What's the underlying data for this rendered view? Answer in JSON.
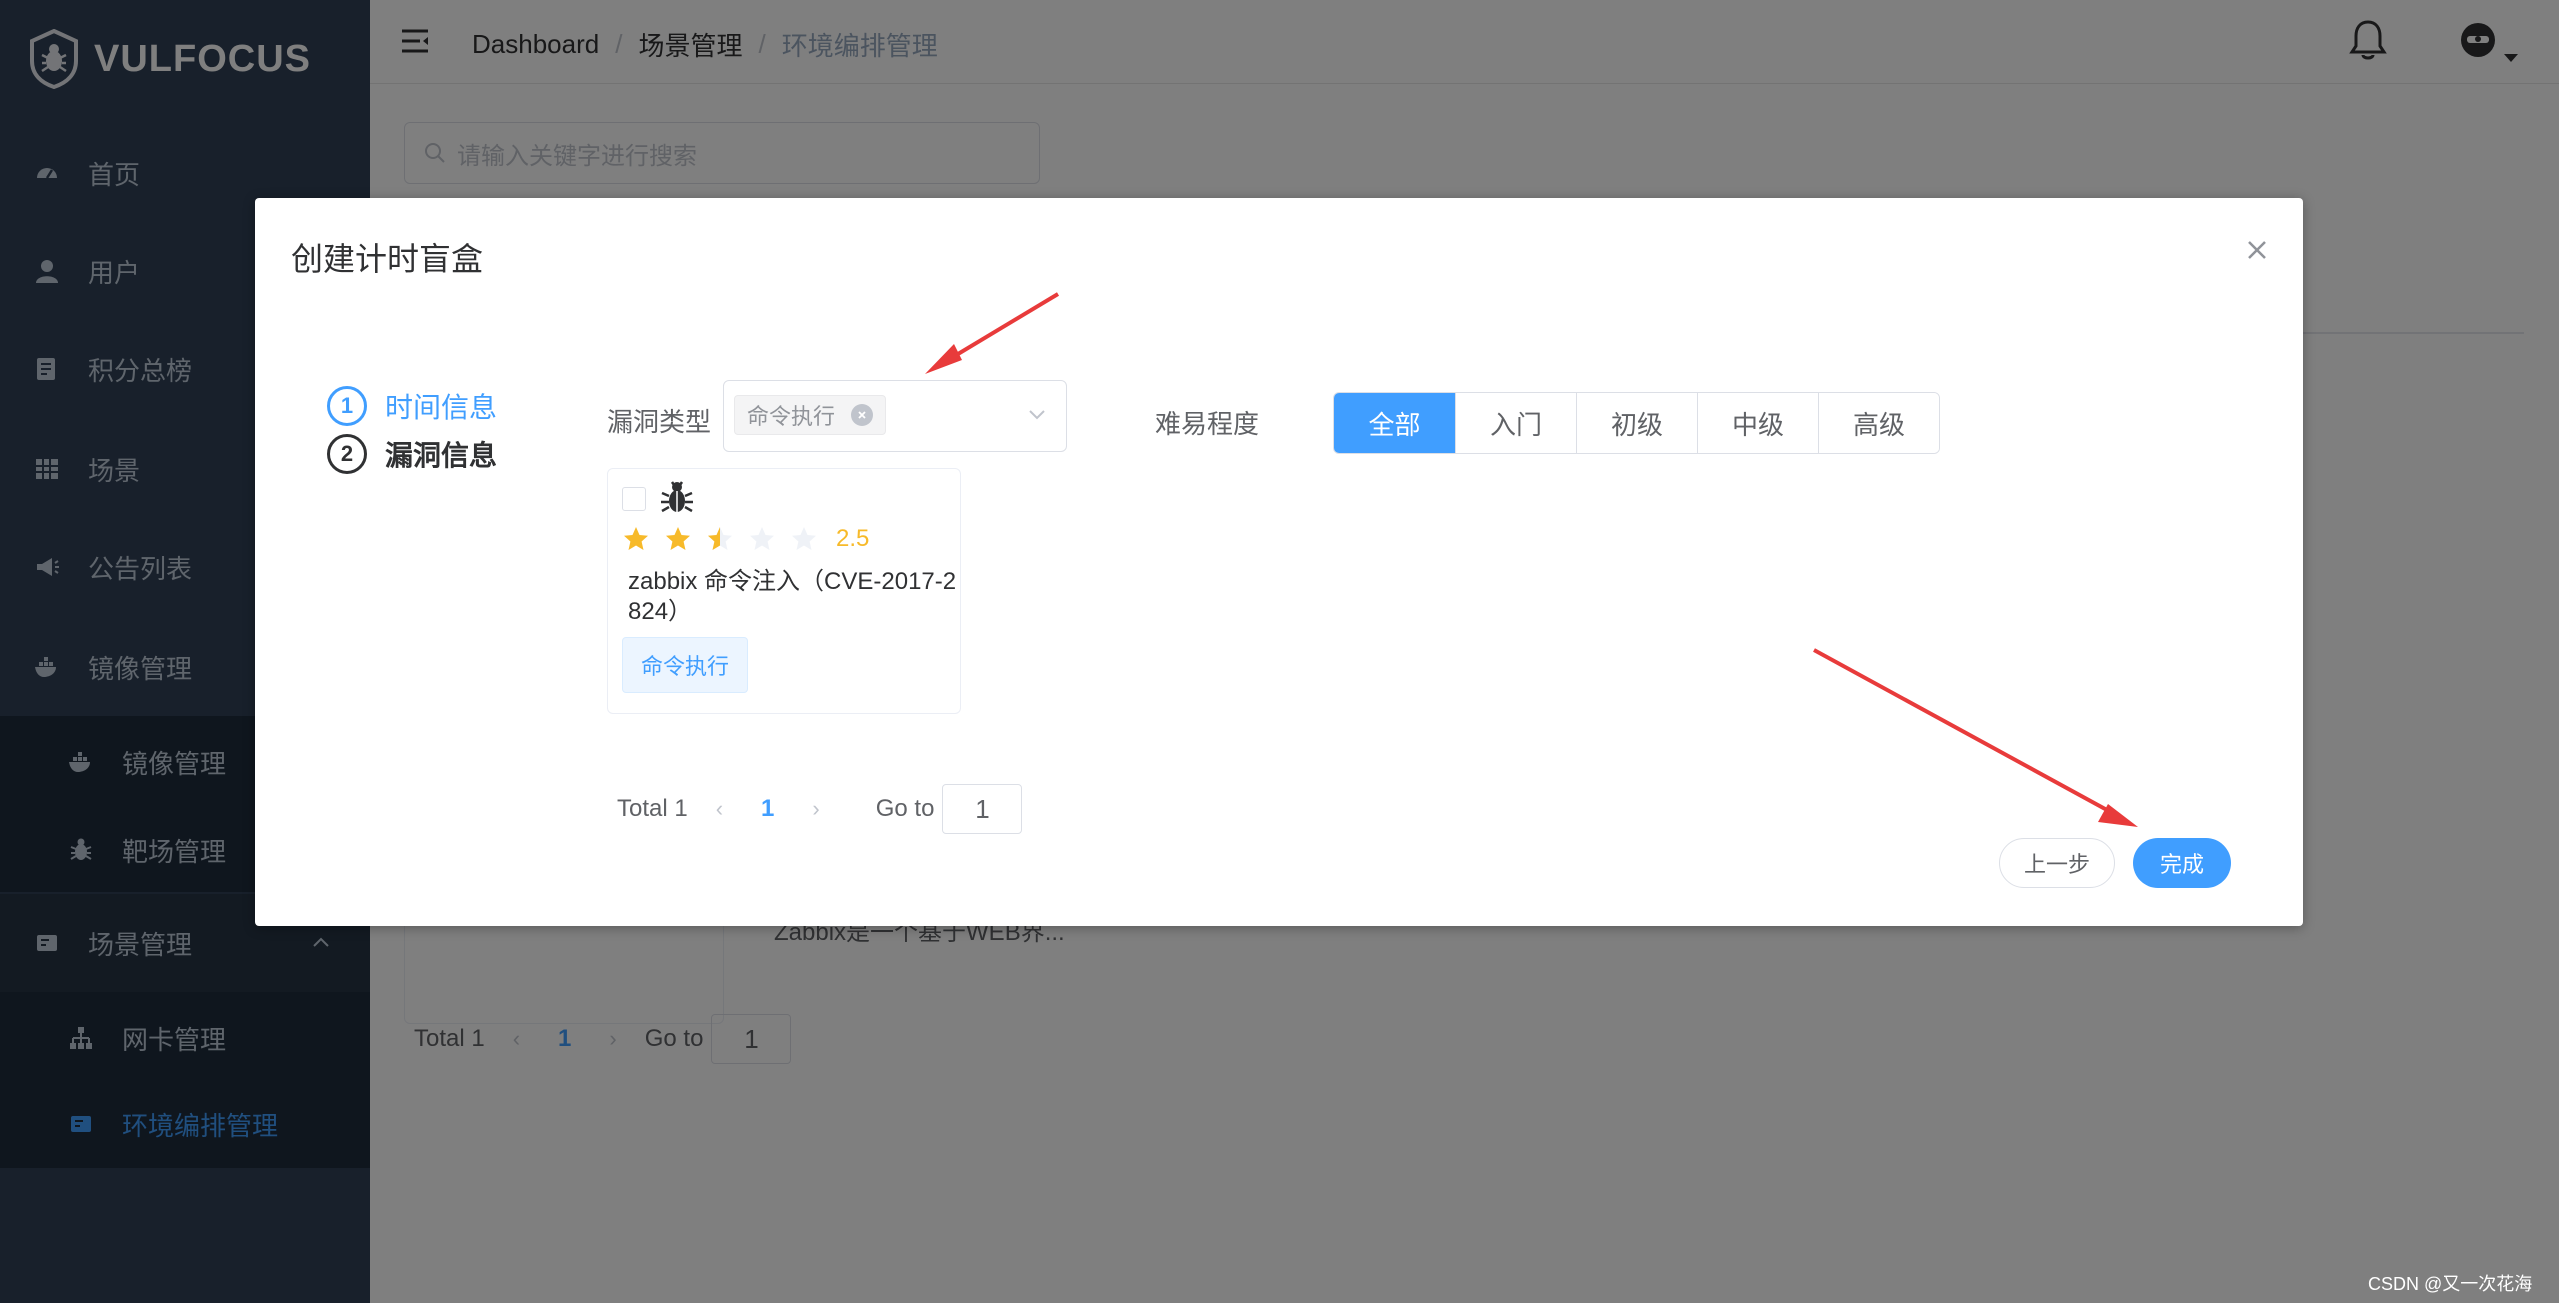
{
  "app": {
    "logo_text": "VULFOCUS"
  },
  "sidebar": {
    "items": [
      {
        "label": "首页",
        "icon": "dashboard-icon"
      },
      {
        "label": "用户",
        "icon": "user-icon"
      },
      {
        "label": "积分总榜",
        "icon": "ranking-icon"
      },
      {
        "label": "场景",
        "icon": "grid-icon"
      },
      {
        "label": "公告列表",
        "icon": "announcement-icon"
      },
      {
        "label": "镜像管理",
        "icon": "docker-icon"
      }
    ],
    "image_sub": [
      {
        "label": "镜像管理",
        "icon": "docker-icon"
      },
      {
        "label": "靶场管理",
        "icon": "bug-icon"
      }
    ],
    "scene_mgmt": {
      "label": "场景管理",
      "icon": "scene-icon"
    },
    "scene_sub": [
      {
        "label": "网卡管理",
        "icon": "network-icon"
      },
      {
        "label": "环境编排管理",
        "icon": "layout-icon"
      }
    ]
  },
  "header": {
    "breadcrumb": [
      "Dashboard",
      "场景管理",
      "环境编排管理"
    ]
  },
  "main": {
    "search_placeholder": "请输入关键字进行搜索",
    "bg_desc": "Zabbix是一个基于WEB界...",
    "pager": {
      "total": "Total 1",
      "current": "1",
      "goto_label": "Go to",
      "goto_value": "1"
    }
  },
  "dialog": {
    "title": "创建计时盲盒",
    "steps": [
      {
        "num": "1",
        "label": "时间信息"
      },
      {
        "num": "2",
        "label": "漏洞信息"
      }
    ],
    "vuln_type_label": "漏洞类型",
    "vuln_type_tag": "命令执行",
    "difficulty_label": "难易程度",
    "difficulty_options": [
      "全部",
      "入门",
      "初级",
      "中级",
      "高级"
    ],
    "difficulty_selected": "全部",
    "card": {
      "rating": 2.5,
      "score": "2.5",
      "name": "zabbix 命令注入（CVE-2017-2824）",
      "tag": "命令执行"
    },
    "pager": {
      "total": "Total 1",
      "current": "1",
      "goto_label": "Go to",
      "goto_value": "1"
    },
    "prev_button": "上一步",
    "done_button": "完成"
  },
  "watermark": "CSDN @又一次花海",
  "colors": {
    "primary": "#409eff",
    "sidebar": "#304156",
    "star": "#f7ba2a",
    "annotation": "#e83b3b"
  }
}
